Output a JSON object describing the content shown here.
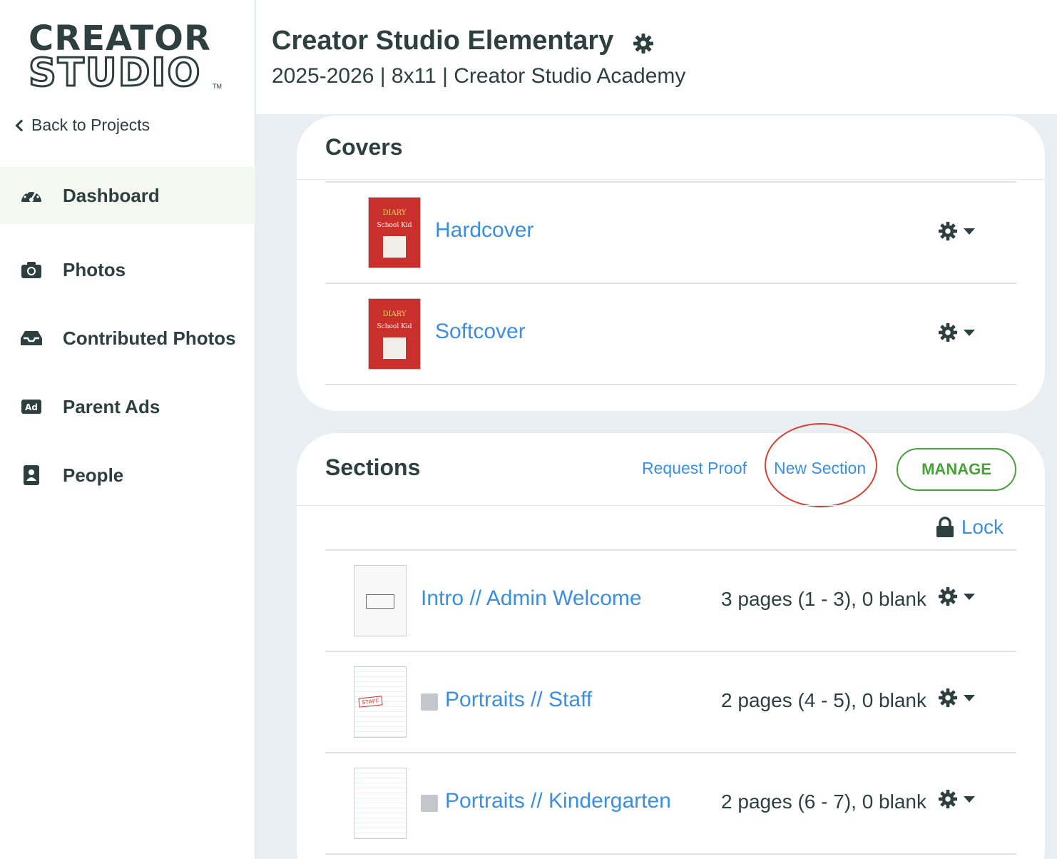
{
  "brand": {
    "logo_line1": "CREATOR",
    "logo_line2": "STUDIO",
    "logo_tm": "TM"
  },
  "sidebar": {
    "back_label": "Back to Projects",
    "items": [
      {
        "label": "Dashboard",
        "icon": "dashboard-gauge-icon",
        "active": true
      },
      {
        "label": "Photos",
        "icon": "camera-icon",
        "active": false
      },
      {
        "label": "Contributed Photos",
        "icon": "inbox-tray-icon",
        "active": false
      },
      {
        "label": "Parent Ads",
        "icon": "ad-badge-icon",
        "active": false
      },
      {
        "label": "People",
        "icon": "person-card-icon",
        "active": false
      }
    ]
  },
  "header": {
    "title": "Creator Studio Elementary",
    "subtitle": "2025-2026 | 8x11 | Creator Studio Academy",
    "settings_icon": "gear-icon"
  },
  "covers": {
    "title": "Covers",
    "items": [
      {
        "name": "Hardcover",
        "thumb_title": "DIARY",
        "thumb_sub": "School Kid"
      },
      {
        "name": "Softcover",
        "thumb_title": "DIARY",
        "thumb_sub": "School Kid"
      }
    ]
  },
  "sections": {
    "title": "Sections",
    "request_proof": "Request Proof",
    "new_section": "New Section",
    "manage": "MANAGE",
    "lock": "Lock",
    "items": [
      {
        "name": "Intro // Admin Welcome",
        "pages": "3 pages (1 - 3), 0 blank",
        "portrait": false
      },
      {
        "name": "Portraits // Staff",
        "pages": "2 pages (4 - 5), 0 blank",
        "portrait": true,
        "badge": "STAFF"
      },
      {
        "name": "Portraits // Kindergarten",
        "pages": "2 pages (6 - 7), 0 blank",
        "portrait": true
      }
    ]
  },
  "colors": {
    "link": "#3a8fe0",
    "manage": "#4aa03c",
    "highlight": "#d9402f",
    "text": "#2d3f3f",
    "cover_red": "#c9302c"
  }
}
